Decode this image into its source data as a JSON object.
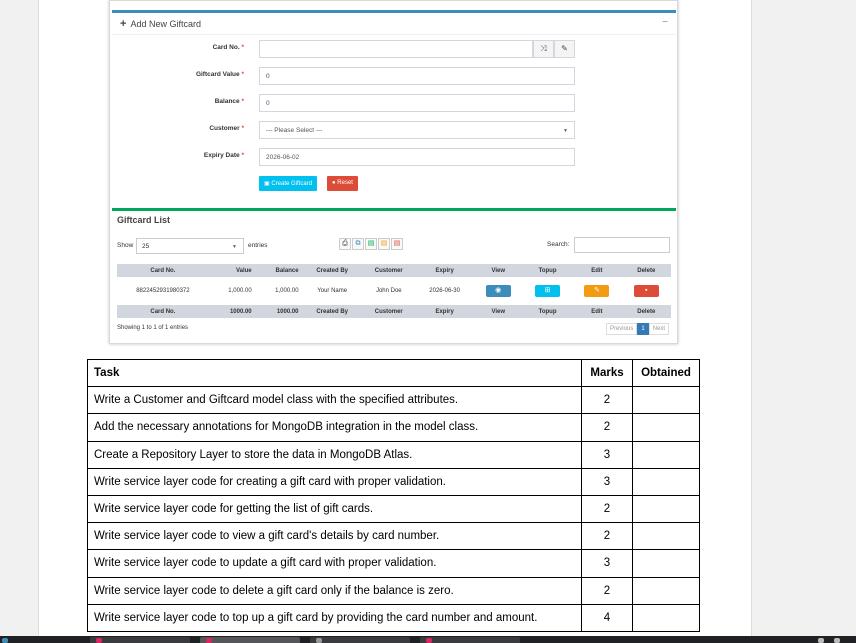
{
  "form": {
    "title": "Add New Giftcard",
    "collapse": "−",
    "card_label": "Card No.",
    "card_value": "",
    "value_label": "Giftcard Value",
    "value_value": "0",
    "balance_label": "Balance",
    "balance_value": "0",
    "customer_label": "Customer",
    "customer_value": "--- Please Select ---",
    "expiry_label": "Expiry Date",
    "expiry_value": "2026-06-02",
    "required": "*",
    "create_btn": "Create Giftcard",
    "reset_btn": "Reset"
  },
  "list": {
    "title": "Giftcard List",
    "show": "Show",
    "entries_value": "25",
    "entries": "entries",
    "search": "Search:",
    "columns": [
      "Card No.",
      "Value",
      "Balance",
      "Created By",
      "Customer",
      "Expiry",
      "View",
      "Topup",
      "Edit",
      "Delete"
    ],
    "row": {
      "card": "8822452931980372",
      "value": "1,000.00",
      "balance": "1,000.00",
      "created_by": "Your Name",
      "customer": "John Doe",
      "expiry": "2026-06-30"
    },
    "footer": [
      "Card No.",
      "1000.00",
      "1000.00",
      "Created By",
      "Customer",
      "Expiry",
      "View",
      "Topup",
      "Edit",
      "Delete"
    ],
    "info": "Showing 1 to 1 of 1 entries",
    "prev": "Previous",
    "page": "1",
    "next": "Next"
  },
  "tasks": {
    "headers": [
      "Task",
      "Marks",
      "Obtained"
    ],
    "rows": [
      {
        "task": "Write a Customer and Giftcard model class with the specified attributes.",
        "marks": "2"
      },
      {
        "task": "Add the necessary annotations for MongoDB integration in the model class.",
        "marks": "2"
      },
      {
        "task": "Create a Repository Layer to store the data in MongoDB Atlas.",
        "marks": "3"
      },
      {
        "task": "Write service layer code for creating a gift card with proper validation.",
        "marks": "3"
      },
      {
        "task": "Write service layer code for getting the list of gift cards.",
        "marks": "2"
      },
      {
        "task": "Write service layer code to view a gift card's details by card number.",
        "marks": "2"
      },
      {
        "task": "Write service layer code to update a gift card with proper validation.",
        "marks": "3"
      },
      {
        "task": "Write service layer code to delete a gift card only if the balance is zero.",
        "marks": "2"
      },
      {
        "task": "Write service layer code to top up a gift card by providing the card number and amount.",
        "marks": "4"
      }
    ]
  },
  "colors": {
    "primary": "#3c8dbc",
    "success": "#00a65a",
    "info": "#00c0ef",
    "warning": "#f39c12",
    "danger": "#dd4b39"
  }
}
